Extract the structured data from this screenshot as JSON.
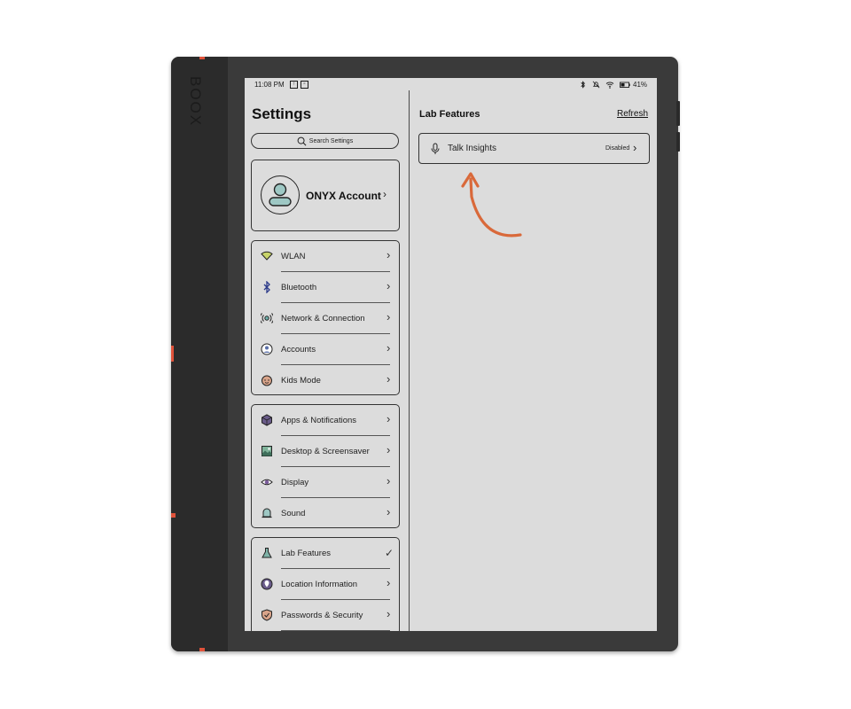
{
  "device": {
    "brand": "BOOX"
  },
  "status_bar": {
    "time": "11:08 PM",
    "battery_percent": "41%",
    "icons": [
      "upload-icon",
      "screenshot-icon",
      "bluetooth-icon",
      "no-sound-icon",
      "wifi-icon",
      "battery-icon"
    ]
  },
  "left_panel": {
    "title": "Settings",
    "search_placeholder": "Search Settings",
    "account_label": "ONYX Account",
    "groups": [
      {
        "items": [
          {
            "label": "WLAN",
            "icon": "wifi-icon"
          },
          {
            "label": "Bluetooth",
            "icon": "bluetooth-icon"
          },
          {
            "label": "Network & Connection",
            "icon": "network-icon"
          },
          {
            "label": "Accounts",
            "icon": "accounts-icon"
          },
          {
            "label": "Kids Mode",
            "icon": "kids-icon"
          }
        ]
      },
      {
        "items": [
          {
            "label": "Apps & Notifications",
            "icon": "apps-icon"
          },
          {
            "label": "Desktop & Screensaver",
            "icon": "desktop-icon"
          },
          {
            "label": "Display",
            "icon": "eye-icon"
          },
          {
            "label": "Sound",
            "icon": "bell-icon"
          }
        ]
      },
      {
        "items": [
          {
            "label": "Lab Features",
            "icon": "flask-icon",
            "selected": true
          },
          {
            "label": "Location Information",
            "icon": "location-icon"
          },
          {
            "label": "Passwords & Security",
            "icon": "shield-icon"
          }
        ]
      }
    ]
  },
  "right_panel": {
    "title": "Lab Features",
    "refresh_label": "Refresh",
    "feature": {
      "label": "Talk Insights",
      "status": "Disabled",
      "icon": "microphone-icon"
    }
  },
  "colors": {
    "annotation_arrow": "#d9693a",
    "screen": "#dcdcdc",
    "device_accent": "#e0523a"
  }
}
